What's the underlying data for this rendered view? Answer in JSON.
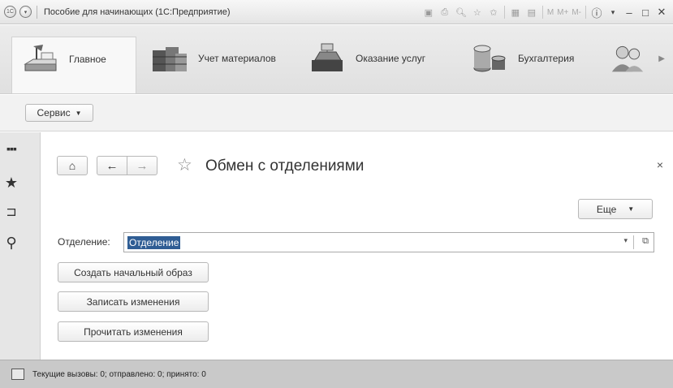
{
  "titlebar": {
    "app_icon": "1С",
    "title": "Пособие для начинающих  (1С:Предприятие)",
    "m_labels": [
      "M",
      "M+",
      "M-"
    ]
  },
  "sections": [
    {
      "label": "Главное",
      "icon": "desk-lamp-icon",
      "active": true
    },
    {
      "label": "Учет материалов",
      "icon": "warehouse-boxes-icon",
      "active": false
    },
    {
      "label": "Оказание услуг",
      "icon": "cash-register-icon",
      "active": false
    },
    {
      "label": "Бухгалтерия",
      "icon": "coins-icon",
      "active": false
    },
    {
      "label": "",
      "icon": "people-icon",
      "active": false
    }
  ],
  "servicebar": {
    "service_label": "Сервис"
  },
  "form": {
    "title": "Обмен с отделениями",
    "more_label": "Еще",
    "field_label": "Отделение:",
    "field_value": "Отделение",
    "buttons": {
      "create_image": "Создать начальный образ",
      "write_changes": "Записать изменения",
      "read_changes": "Прочитать изменения"
    }
  },
  "statusbar": {
    "text": "Текущие вызовы: 0; отправлено: 0; принято: 0"
  },
  "colors": {
    "selection": "#2f5d94",
    "statusbar": "#c9c9c9",
    "sections_bg": "#e6e6e6"
  }
}
